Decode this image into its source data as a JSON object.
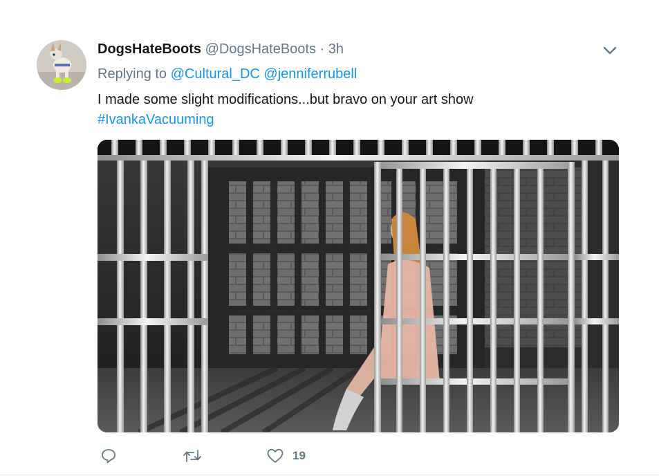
{
  "tweet": {
    "display_name": "DogsHateBoots",
    "handle": "@DogsHateBoots",
    "separator": "·",
    "timestamp": "3h",
    "replying_label": "Replying to",
    "reply_to": [
      "@Cultural_DC",
      "@jenniferrubell"
    ],
    "text": "I made some slight modifications...but bravo on your art show",
    "hashtag": "#IvankaVacuuming",
    "like_count": "19"
  },
  "icons": {
    "menu": "chevron-down-icon",
    "reply": "reply-icon",
    "retweet": "retweet-icon",
    "like": "heart-icon"
  },
  "colors": {
    "link": "#1b95e0",
    "muted": "#657786",
    "text": "#14171a"
  }
}
